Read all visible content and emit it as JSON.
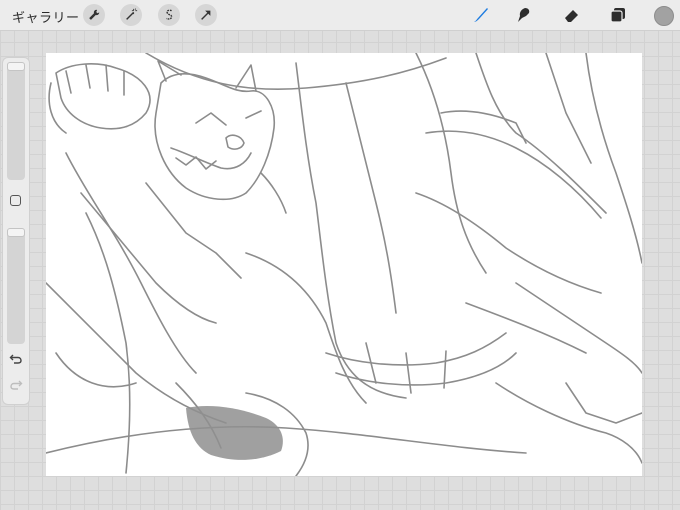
{
  "toolbar": {
    "gallery_label": "ギャラリー",
    "left_tools": [
      "wrench-icon",
      "magic-wand-icon",
      "selection-s-icon",
      "transform-arrow-icon"
    ],
    "right_tools": [
      "brush-icon",
      "smudge-icon",
      "eraser-icon",
      "layers-icon"
    ],
    "active_tool": "brush",
    "active_color": "#1e7ce0",
    "current_color": "#a2a2a2"
  },
  "sidebar": {
    "brush_size_level": 0.0,
    "opacity_level": 0.0,
    "controls": [
      "brush-size-slider",
      "modify-button",
      "opacity-slider",
      "undo-icon",
      "redo-icon"
    ]
  },
  "canvas": {
    "stroke_color": "#8c8c8c",
    "fill_color": "#8f8f8f"
  }
}
